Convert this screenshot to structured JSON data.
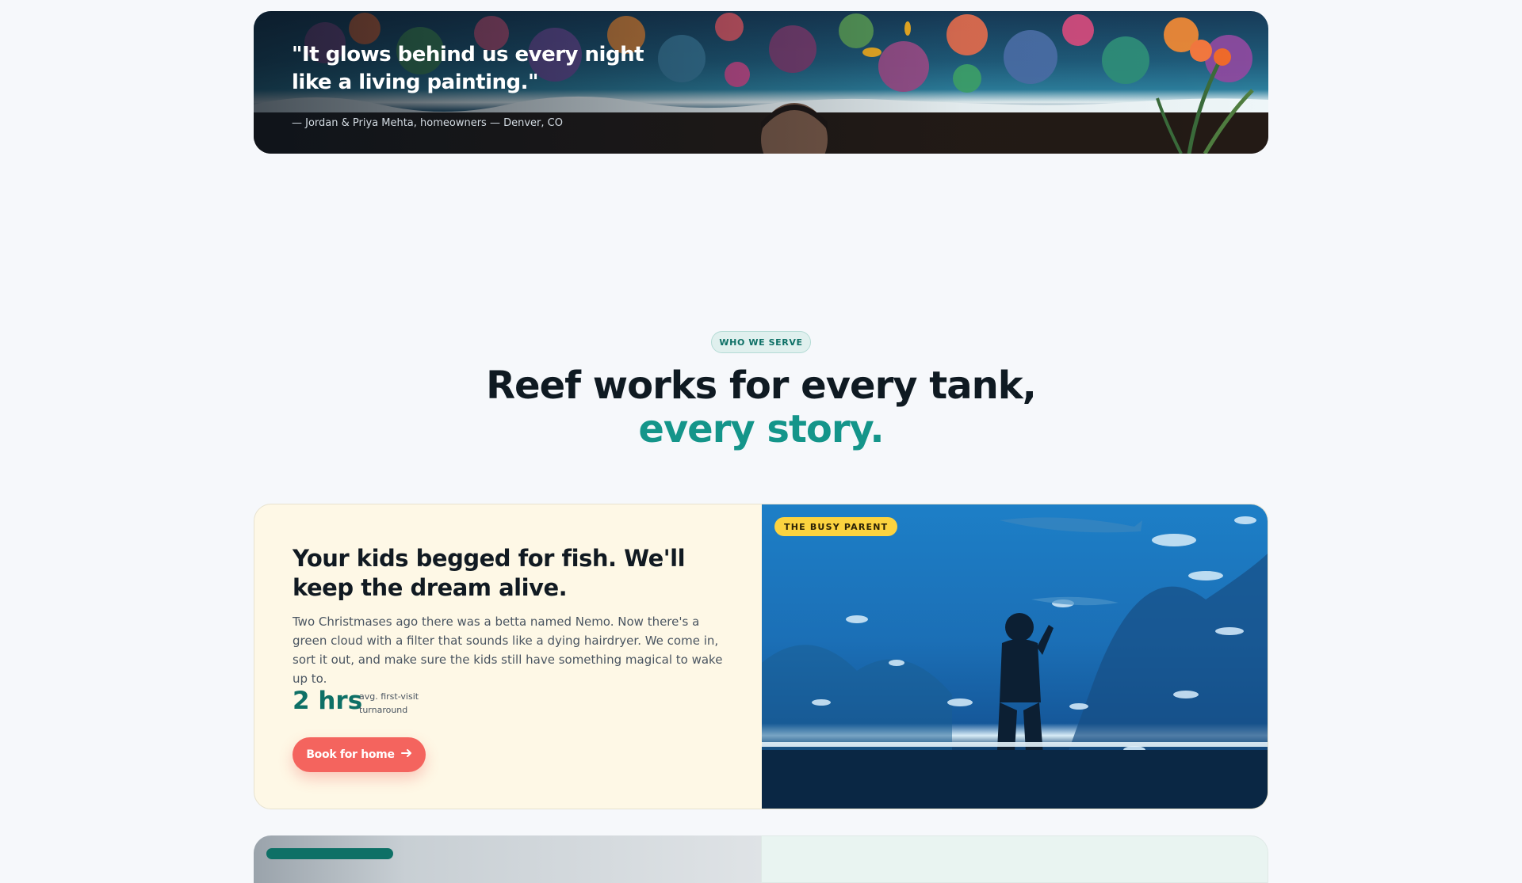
{
  "testimonial": {
    "quote": "\"It glows behind us every night like a living painting.\"",
    "attribution": "— Jordan & Priya Mehta, homeowners — Denver, CO"
  },
  "section": {
    "eyebrow": "WHO WE SERVE",
    "title_line1": "Reef works for every tank,",
    "title_line2": "every story."
  },
  "cards": [
    {
      "title": "Your kids begged for fish. We'll keep the dream alive.",
      "description": "Two Christmases ago there was a betta named Nemo. Now there's a green cloud with a filter that sounds like a dying hairdryer. We come in, sort it out, and make sure the kids still have something magical to wake up to.",
      "stat_value": "2 hrs",
      "stat_label": "avg. first-visit turnaround",
      "cta_label": "Book for home",
      "cta_icon": "arrow-right-icon",
      "image_tag": "THE BUSY PARENT"
    }
  ],
  "colors": {
    "background": "#f6f8fb",
    "accent_teal": "#14958a",
    "cta_coral": "#f4645e",
    "tag_yellow": "#fcd33f",
    "card_cream": "#fef8e6"
  }
}
